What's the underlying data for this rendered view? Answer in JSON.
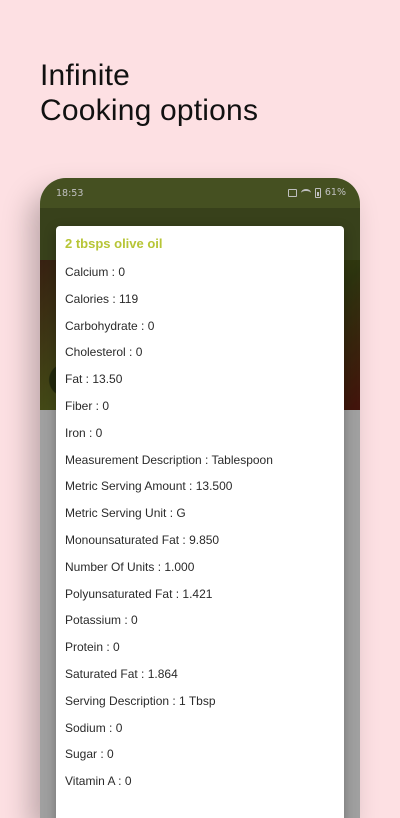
{
  "headline": {
    "line1": "Infinite",
    "line2": "Cooking options"
  },
  "status_bar": {
    "time": "18:53",
    "battery": "61%",
    "icons": [
      "vibrate-icon",
      "wifi-icon",
      "battery-icon"
    ]
  },
  "dialog": {
    "title": "2 tbsps olive oil",
    "nutrients": [
      "Calcium : 0",
      "Calories : 119",
      "Carbohydrate : 0",
      "Cholesterol : 0",
      "Fat : 13.50",
      "Fiber : 0",
      "Iron : 0",
      "Measurement Description : Tablespoon",
      "Metric Serving Amount : 13.500",
      "Metric Serving Unit : G",
      "Monounsaturated Fat : 9.850",
      "Number Of Units : 1.000",
      "Polyunsaturated Fat : 1.421",
      "Potassium : 0",
      "Protein : 0",
      "Saturated Fat : 1.864",
      "Serving Description : 1 Tbsp",
      "Sodium : 0",
      "Sugar : 0",
      "Vitamin A : 0"
    ]
  },
  "colors": {
    "background": "#fde0e3",
    "app_bar": "#5c6b2d",
    "accent": "#b7c536"
  }
}
